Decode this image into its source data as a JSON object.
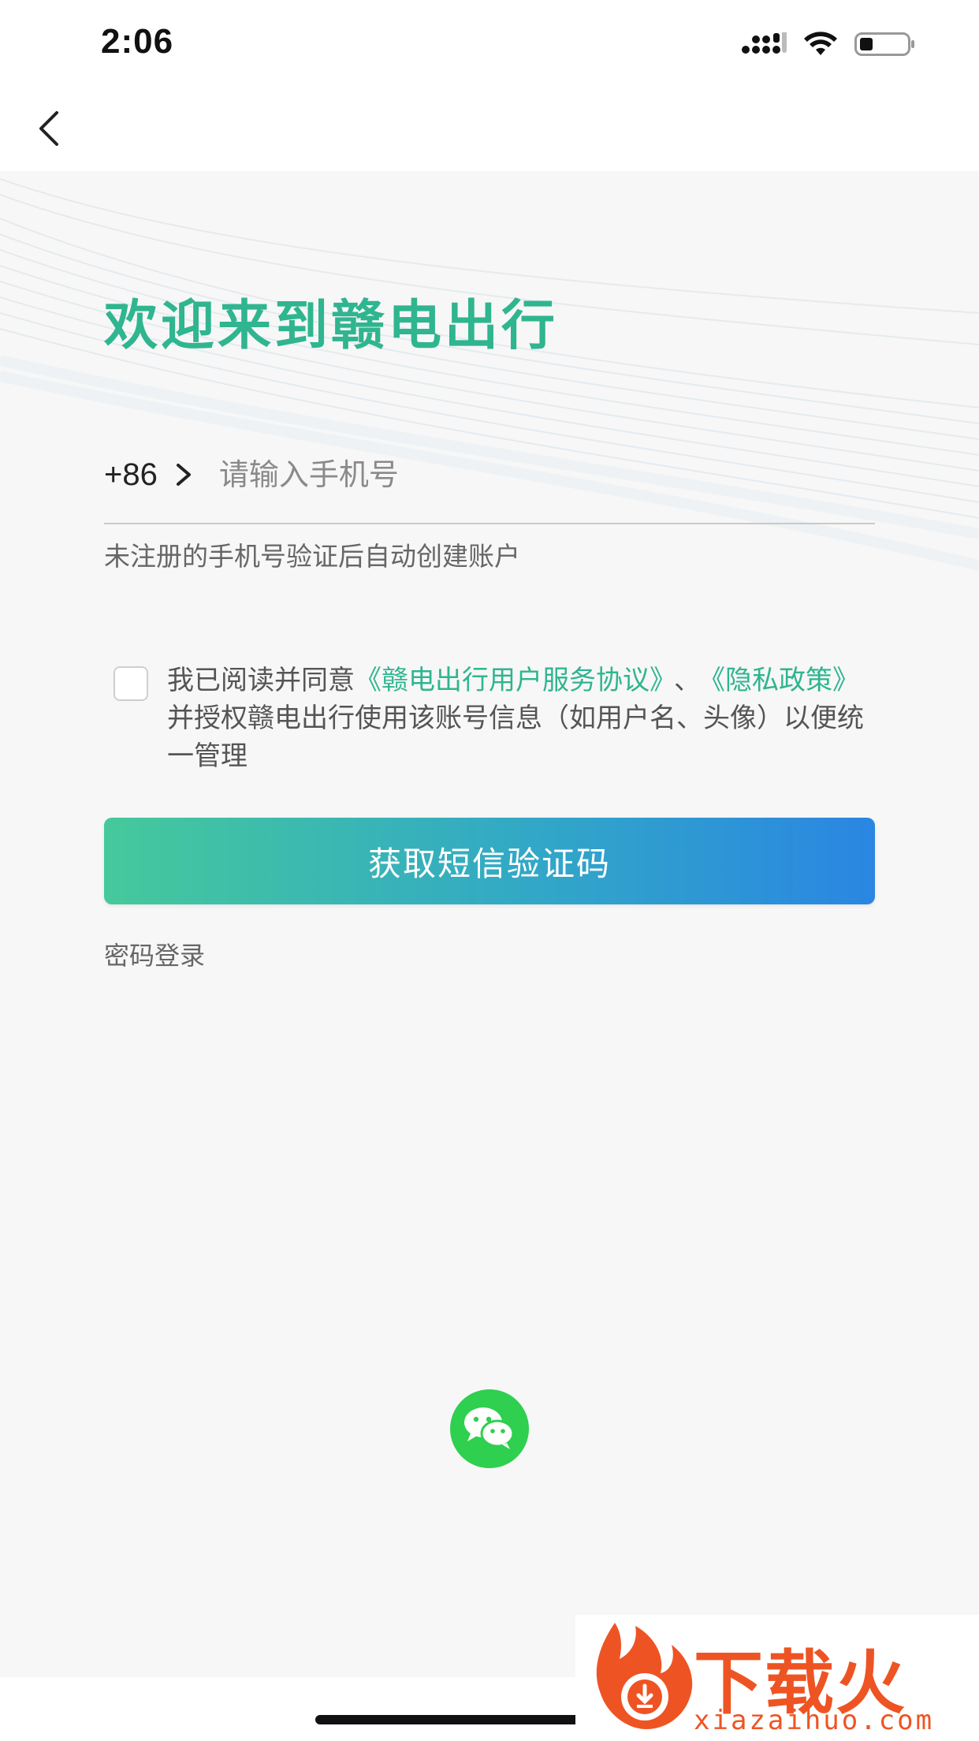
{
  "status_bar": {
    "time": "2:06"
  },
  "nav": {
    "back_icon": "chevron-left-icon"
  },
  "login": {
    "title": "欢迎来到赣电出行",
    "country_code": "+86",
    "phone_placeholder": "请输入手机号",
    "phone_value": "",
    "hint": "未注册的手机号验证后自动创建账户",
    "agreement": {
      "checked": false,
      "prefix": "我已阅读并同意",
      "user_agreement": "《赣电出行用户服务协议》",
      "separator": "、",
      "privacy_policy": "《隐私政策》",
      "suffix": "并授权赣电出行使用该账号信息（如用户名、头像）以便统一管理"
    },
    "sms_button": "获取短信验证码",
    "password_login": "密码登录",
    "wechat_icon": "wechat-icon"
  },
  "watermark": {
    "name": "下载火",
    "domain": "xiazaihuo.com"
  },
  "colors": {
    "brand_green": "#2fb58f",
    "button_gradient_start": "#45c99b",
    "button_gradient_end": "#2a86e2",
    "wechat_green": "#2fcf4f",
    "watermark_orange": "#ee5423"
  }
}
